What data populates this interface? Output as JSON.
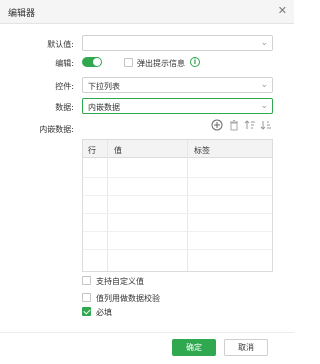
{
  "dialog": {
    "title": "编辑器",
    "close_icon": "close-icon"
  },
  "form": {
    "default_label": "默认值:",
    "edit_label": "编辑:",
    "edit_enabled": true,
    "popup_label": "弹出提示信息",
    "popup_checked": false,
    "control_label": "控件:",
    "control_value": "下拉列表",
    "data_label": "数据:",
    "data_value": "内嵌数据",
    "embedded_label": "内嵌数据:"
  },
  "table": {
    "columns": [
      "行",
      "值",
      "标签"
    ],
    "rows": []
  },
  "options": {
    "custom_value": {
      "label": "支持自定义值",
      "checked": false
    },
    "validate": {
      "label": "值列用做数据校验",
      "checked": false
    },
    "required": {
      "label": "必填",
      "checked": true
    }
  },
  "buttons": {
    "ok": "确定",
    "cancel": "取消"
  },
  "colors": {
    "accent": "#2fa84f"
  }
}
